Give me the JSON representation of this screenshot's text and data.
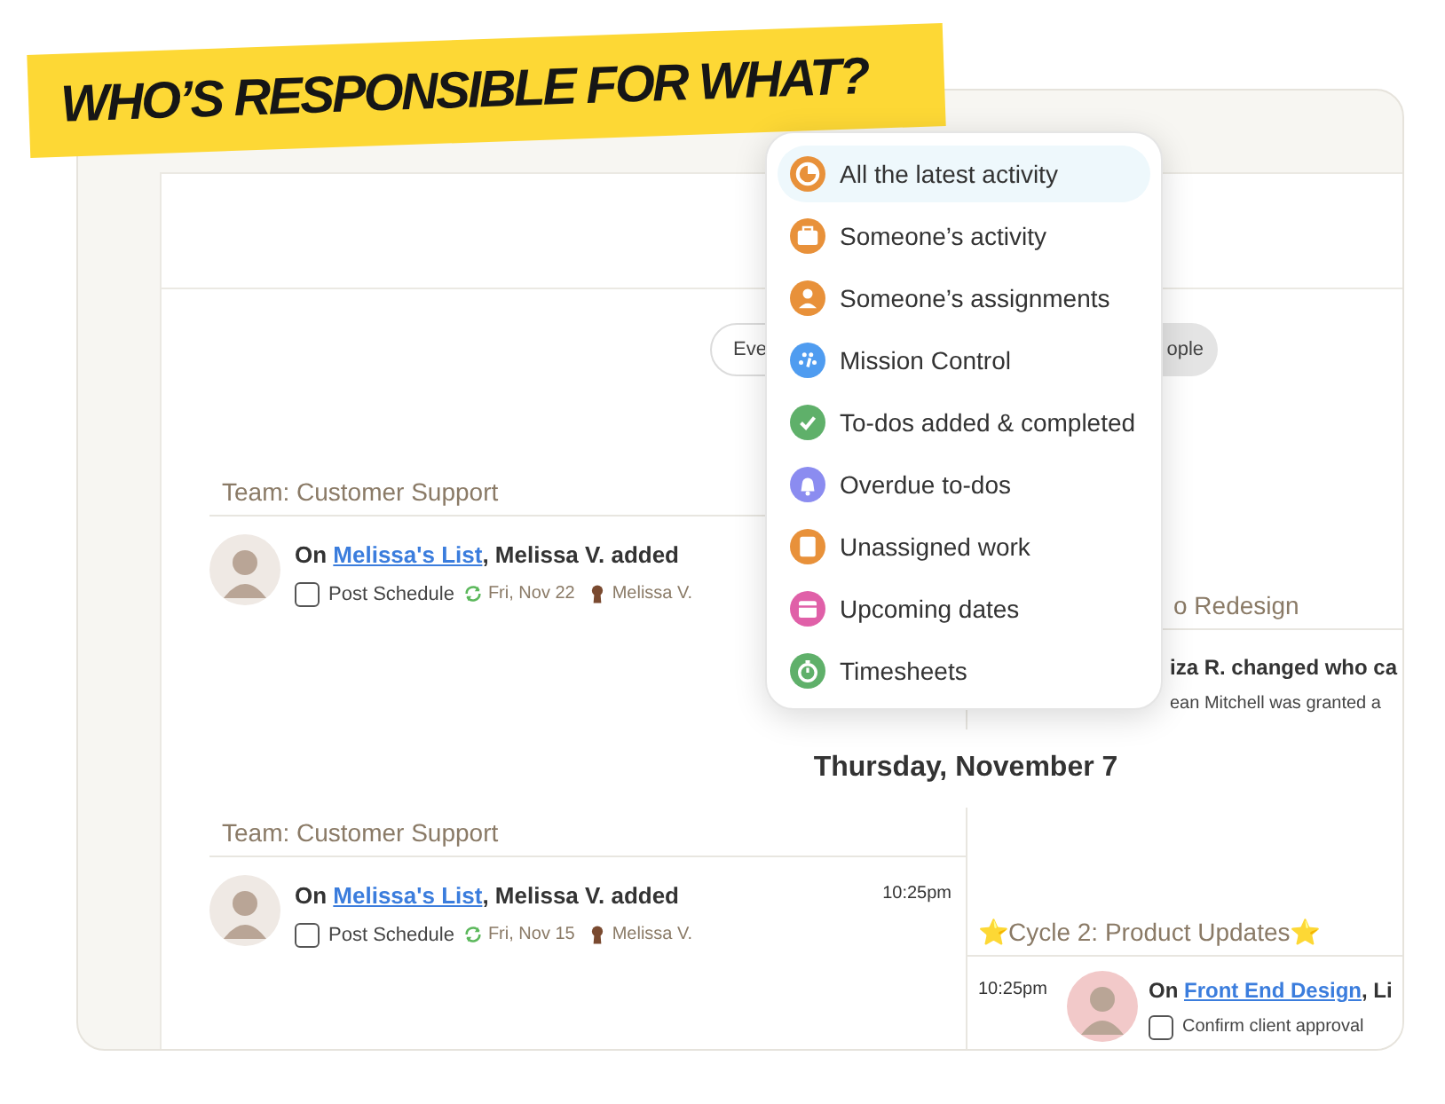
{
  "banner": {
    "title": "WHO’S RESPONSIBLE FOR WHAT?"
  },
  "filters": [
    {
      "label": "Eve",
      "selected": false
    },
    {
      "label": "ople",
      "selected": true
    }
  ],
  "menu": [
    {
      "label": "All the latest activity",
      "color": "#e8913a",
      "selected": true
    },
    {
      "label": "Someone’s activity",
      "color": "#e8913a",
      "selected": false
    },
    {
      "label": "Someone’s assignments",
      "color": "#e8913a",
      "selected": false
    },
    {
      "label": "Mission Control",
      "color": "#4f9cf0",
      "selected": false
    },
    {
      "label": "To-dos added & completed",
      "color": "#5fb06a",
      "selected": false
    },
    {
      "label": "Overdue to-dos",
      "color": "#8b8cf0",
      "selected": false
    },
    {
      "label": "Unassigned work",
      "color": "#e8913a",
      "selected": false
    },
    {
      "label": "Upcoming dates",
      "color": "#e060a8",
      "selected": false
    },
    {
      "label": "Timesheets",
      "color": "#5fb06a",
      "selected": false
    }
  ],
  "section_1": {
    "left": {
      "team": "Team: Customer Support",
      "entry": {
        "prefix": "On ",
        "link": "Melissa's List",
        "suffix": ", Melissa V. added",
        "todo": {
          "label": "Post Schedule",
          "checked": false,
          "date": "Fri, Nov 22",
          "assignee": "Melissa V."
        }
      }
    },
    "right": {
      "team": "o Redesign",
      "headline": "iza R. changed who ca",
      "detail": "ean Mitchell was granted a"
    }
  },
  "day_heading": "Thursday, November 7",
  "section_2": {
    "left": {
      "team": "Team: Customer Support",
      "entry": {
        "prefix": "On ",
        "link": "Melissa's List",
        "suffix": ", Melissa V. added",
        "time": "10:25pm",
        "todo": {
          "label": "Post Schedule",
          "checked": false,
          "date": "Fri, Nov 15",
          "assignee": "Melissa V."
        }
      }
    },
    "right": {
      "team": "⭐Cycle 2: Product Updates⭐",
      "entry": {
        "time": "10:25pm",
        "prefix": "On ",
        "link": "Front End Design",
        "suffix": ", Li",
        "todo": {
          "label": "Confirm client approval",
          "checked": false
        }
      }
    }
  }
}
